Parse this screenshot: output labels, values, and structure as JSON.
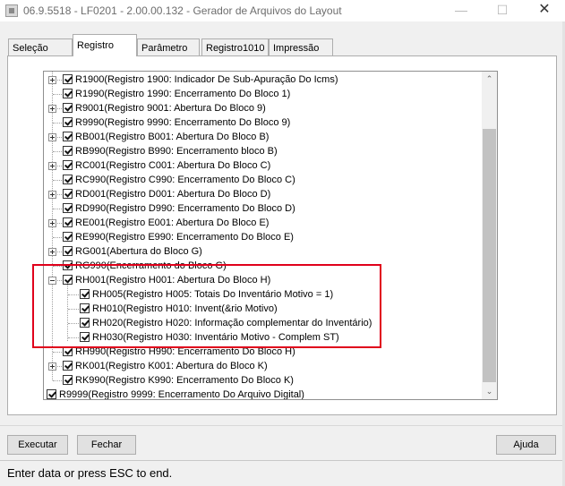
{
  "window": {
    "title": "06.9.5518 - LF0201 - 2.00.00.132 - Gerador de Arquivos do Layout",
    "minimize_glyph": "—",
    "maximize_glyph": "☐",
    "close_glyph": "✕"
  },
  "tabs": [
    "Seleção",
    "Registro",
    "Parâmetro",
    "Registro1010",
    "Impressão"
  ],
  "active_tab": "Registro",
  "tree": {
    "items": [
      {
        "label": "R1900(Registro 1900: Indicador De Sub-Apuração Do Icms)",
        "level": 1,
        "expander": "plus",
        "checked": true
      },
      {
        "label": "R1990(Registro 1990: Encerramento Do Bloco 1)",
        "level": 1,
        "expander": "none",
        "checked": true
      },
      {
        "label": "R9001(Registro 9001: Abertura Do Bloco 9)",
        "level": 1,
        "expander": "plus",
        "checked": true
      },
      {
        "label": "R9990(Registro 9990: Encerramento Do Bloco 9)",
        "level": 1,
        "expander": "none",
        "checked": true
      },
      {
        "label": "RB001(Registro B001: Abertura Do Bloco B)",
        "level": 1,
        "expander": "plus",
        "checked": true
      },
      {
        "label": "RB990(Registro B990: Encerramento bloco B)",
        "level": 1,
        "expander": "none",
        "checked": true
      },
      {
        "label": "RC001(Registro C001: Abertura Do Bloco C)",
        "level": 1,
        "expander": "plus",
        "checked": true
      },
      {
        "label": "RC990(Registro C990: Encerramento Do Bloco C)",
        "level": 1,
        "expander": "none",
        "checked": true
      },
      {
        "label": "RD001(Registro D001: Abertura Do Bloco D)",
        "level": 1,
        "expander": "plus",
        "checked": true
      },
      {
        "label": "RD990(Registro D990: Encerramento Do Bloco D)",
        "level": 1,
        "expander": "none",
        "checked": true
      },
      {
        "label": "RE001(Registro E001: Abertura Do Bloco E)",
        "level": 1,
        "expander": "plus",
        "checked": true
      },
      {
        "label": "RE990(Registro E990: Encerramento Do Bloco E)",
        "level": 1,
        "expander": "none",
        "checked": true
      },
      {
        "label": "RG001(Abertura do Bloco G)",
        "level": 1,
        "expander": "plus",
        "checked": true
      },
      {
        "label": "RG990(Encerramento do Bloco G)",
        "level": 1,
        "expander": "none",
        "checked": true
      },
      {
        "label": "RH001(Registro H001: Abertura Do Bloco H)",
        "level": 1,
        "expander": "minus",
        "checked": true
      },
      {
        "label": "RH005(Registro H005: Totais Do Inventário Motivo = 1)",
        "level": 2,
        "expander": "none",
        "checked": true
      },
      {
        "label": "RH010(Registro H010: Invent(&rio Motivo)",
        "level": 2,
        "expander": "none",
        "checked": true
      },
      {
        "label": "RH020(Registro H020: Informação complementar do Inventário)",
        "level": 2,
        "expander": "none",
        "checked": true
      },
      {
        "label": "RH030(Registro H030: Inventário Motivo - Complem ST)",
        "level": 2,
        "expander": "none",
        "checked": true
      },
      {
        "label": "RH990(Registro H990: Encerramento Do Bloco H)",
        "level": 1,
        "expander": "none",
        "checked": true
      },
      {
        "label": "RK001(Registro K001: Abertura do Bloco K)",
        "level": 1,
        "expander": "plus",
        "checked": true
      },
      {
        "label": "RK990(Registro K990: Encerramento Do Bloco K)",
        "level": 1,
        "expander": "none",
        "checked": true
      },
      {
        "label": "R9999(Registro 9999: Encerramento Do Arquivo Digital)",
        "level": 0,
        "expander": "none",
        "checked": true
      }
    ]
  },
  "scrollbar": {
    "up_glyph": "⌃",
    "down_glyph": "⌄"
  },
  "buttons": {
    "execute": "Executar",
    "close": "Fechar",
    "help": "Ajuda"
  },
  "status": {
    "text": "Enter data or press ESC to end."
  },
  "colors": {
    "highlight": "#e0001b",
    "tree_bg": "#ffffff",
    "window_bg": "#f0f0f0"
  }
}
